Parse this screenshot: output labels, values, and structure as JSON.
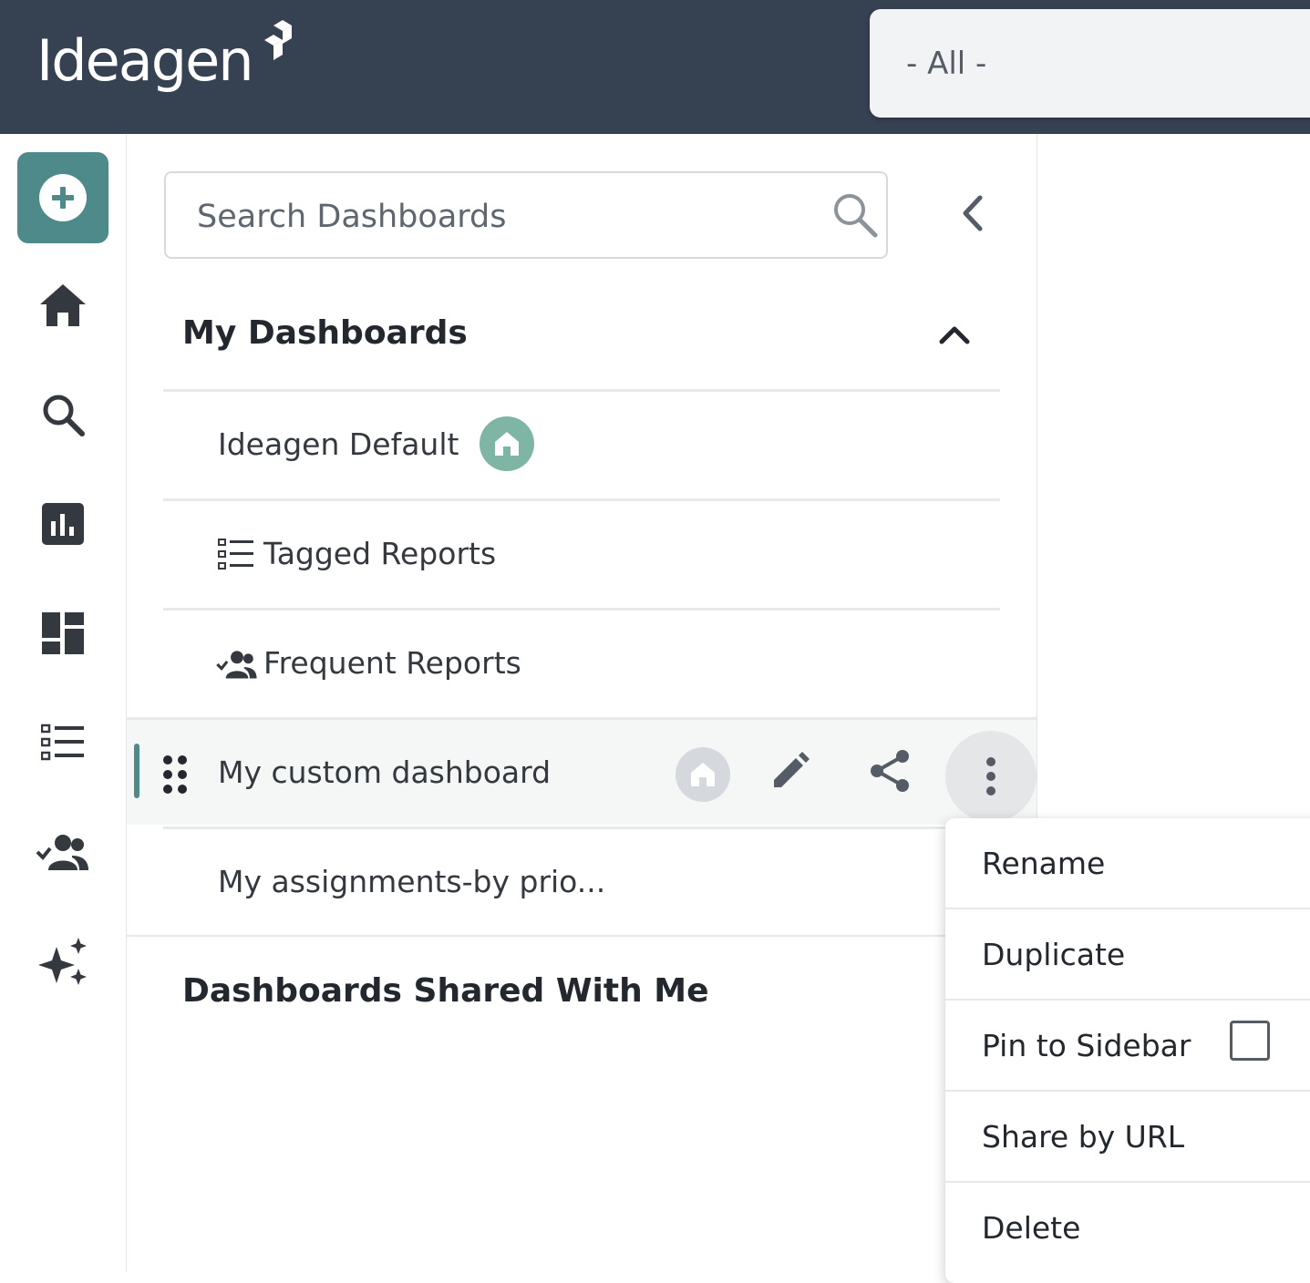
{
  "header": {
    "logo_text": "Ideagen",
    "scope_select_value": "- All -"
  },
  "rail": {
    "items": [
      {
        "name": "new",
        "icon": "plus-circle-icon"
      },
      {
        "name": "home",
        "icon": "home-icon"
      },
      {
        "name": "search",
        "icon": "search-icon"
      },
      {
        "name": "reports",
        "icon": "bar-chart-icon"
      },
      {
        "name": "dashboards",
        "icon": "dashboard-icon"
      },
      {
        "name": "lists",
        "icon": "list-icon"
      },
      {
        "name": "assignments",
        "icon": "people-check-icon"
      },
      {
        "name": "ai",
        "icon": "sparkle-icon"
      }
    ]
  },
  "panel": {
    "search": {
      "placeholder": "Search Dashboards",
      "value": ""
    },
    "my_dashboards": {
      "title": "My Dashboards",
      "items": [
        {
          "label": "Ideagen Default",
          "is_home": true
        },
        {
          "label": "Tagged Reports",
          "icon": "list-icon"
        },
        {
          "label": "Frequent Reports",
          "icon": "people-check-icon"
        },
        {
          "label": "My custom dashboard",
          "selected": true
        },
        {
          "label": "My assignments-by prio..."
        }
      ]
    },
    "shared": {
      "title": "Dashboards Shared With Me"
    }
  },
  "context_menu": {
    "items": [
      {
        "label": "Rename"
      },
      {
        "label": "Duplicate"
      },
      {
        "label": "Pin to Sidebar",
        "checked": false
      },
      {
        "label": "Share by URL"
      },
      {
        "label": "Delete"
      }
    ]
  },
  "colors": {
    "header_bg": "#364152",
    "accent": "#4f8a8b",
    "home_badge": "#7fb5a4"
  }
}
